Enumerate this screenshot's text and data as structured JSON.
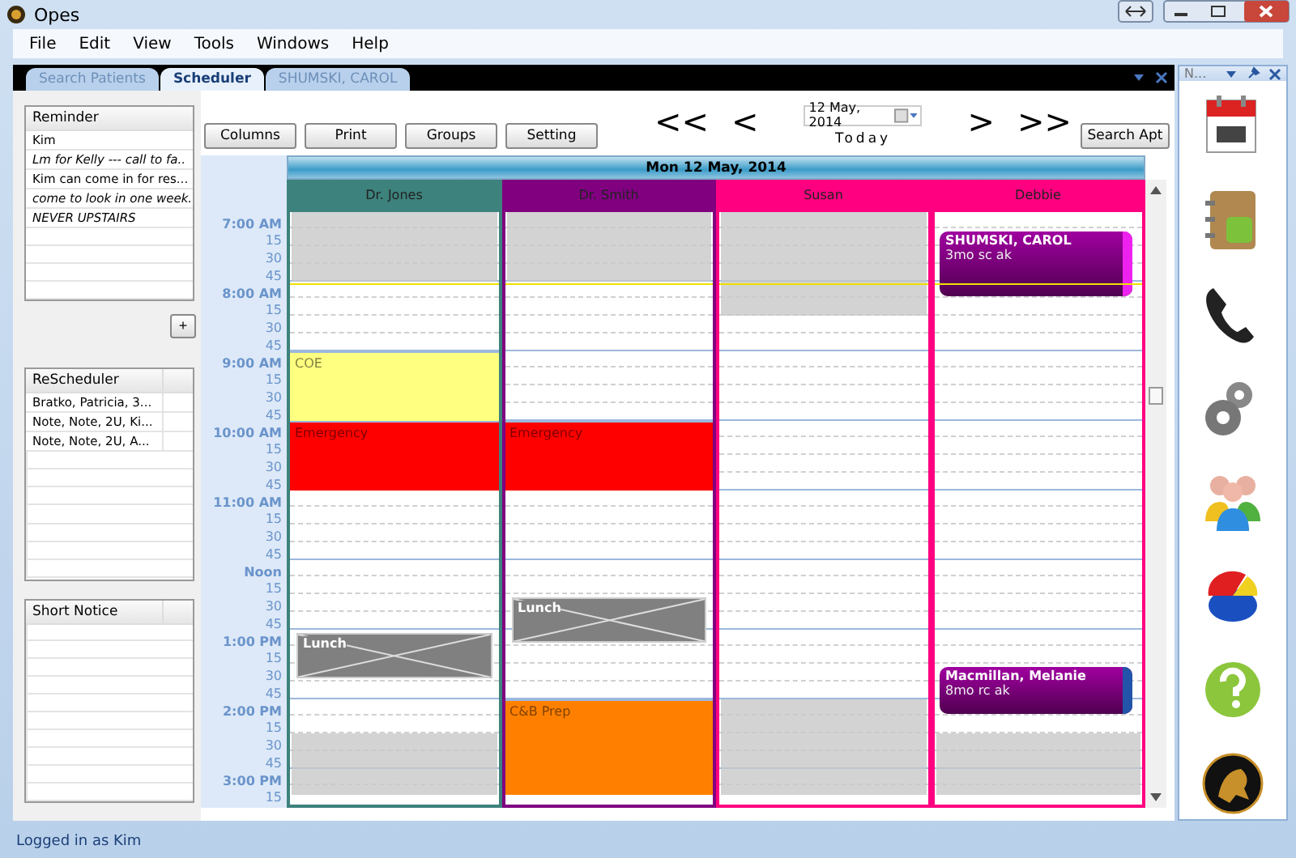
{
  "window": {
    "title": "Opes"
  },
  "menu": [
    "File",
    "Edit",
    "View",
    "Tools",
    "Windows",
    "Help"
  ],
  "tabs": [
    {
      "label": "Search Patients",
      "selected": false
    },
    {
      "label": "Scheduler",
      "selected": true
    },
    {
      "label": "SHUMSKI, CAROL",
      "selected": false
    }
  ],
  "reminder": {
    "title": "Reminder",
    "items": [
      {
        "text": "Kim",
        "italic": false
      },
      {
        "text": "Lm for Kelly --- call to fa..",
        "italic": true
      },
      {
        "text": "Kim can come in for res...",
        "italic": false
      },
      {
        "text": "come to look in one week.",
        "italic": true
      },
      {
        "text": "NEVER UPSTAIRS",
        "italic": true
      }
    ]
  },
  "add_button": "+",
  "rescheduler": {
    "title": "ReScheduler",
    "items": [
      "Bratko, Patricia, 3...",
      "Note, Note, 2U, Ki...",
      "Note, Note, 2U, A..."
    ]
  },
  "short_notice": {
    "title": "Short Notice"
  },
  "toolbar": {
    "buttons": [
      "Columns",
      "Print",
      "Groups",
      "Setting"
    ],
    "nav_back": [
      "<<",
      "<"
    ],
    "date": "12 May, 2014",
    "today": "Today",
    "nav_forward": [
      ">",
      ">>"
    ],
    "search_button": "Search Apt"
  },
  "schedule": {
    "date_header": "Mon 12 May, 2014",
    "columns": [
      {
        "name": "Dr. Jones",
        "color": "#3d827c"
      },
      {
        "name": "Dr. Smith",
        "color": "#800080"
      },
      {
        "name": "Susan",
        "color": "#ff0080"
      },
      {
        "name": "Debbie",
        "color": "#ff0080"
      }
    ],
    "rows": [
      {
        "time": "7:00 AM",
        "current": false,
        "cells": [
          {
            "kind": "unavailable"
          },
          {
            "kind": "unavailable"
          },
          {
            "kind": "unavailable"
          },
          {
            "kind": "free"
          }
        ]
      },
      {
        "time": "15",
        "current": false,
        "cells": [
          {
            "kind": "unavailable"
          },
          {
            "kind": "unavailable"
          },
          {
            "kind": "unavailable"
          },
          {
            "kind": "appointment",
            "name": "SHUMSKI, CAROL",
            "note": "3mo sc ak",
            "color": "#ee22ee"
          }
        ]
      },
      {
        "time": "30",
        "current": false,
        "cells": [
          {
            "kind": "unavailable"
          },
          {
            "kind": "unavailable"
          },
          {
            "kind": "unavailable"
          },
          {
            "kind": "cont"
          }
        ]
      },
      {
        "time": "45",
        "current": false,
        "cells": [
          {
            "kind": "unavailable"
          },
          {
            "kind": "unavailable"
          },
          {
            "kind": "unavailable"
          },
          {
            "kind": "cont"
          }
        ]
      },
      {
        "time": "8:00 AM",
        "current": true,
        "cells": [
          {
            "kind": "free"
          },
          {
            "kind": "free"
          },
          {
            "kind": "unavailable"
          },
          {
            "kind": "cont"
          }
        ]
      },
      {
        "time": "15",
        "current": false,
        "cells": [
          {
            "kind": "free"
          },
          {
            "kind": "free"
          },
          {
            "kind": "unavailable"
          },
          {
            "kind": "free"
          }
        ]
      },
      {
        "time": "30",
        "current": false,
        "cells": [
          {
            "kind": "free"
          },
          {
            "kind": "free"
          },
          {
            "kind": "free"
          },
          {
            "kind": "free"
          }
        ]
      },
      {
        "time": "45",
        "current": false,
        "cells": [
          {
            "kind": "free"
          },
          {
            "kind": "free"
          },
          {
            "kind": "free"
          },
          {
            "kind": "free"
          }
        ]
      },
      {
        "time": "9:00 AM",
        "current": false,
        "cells": [
          {
            "kind": "block",
            "label": "COE",
            "color": "#ffff80"
          },
          {
            "kind": "free"
          },
          {
            "kind": "free"
          },
          {
            "kind": "free"
          }
        ]
      },
      {
        "time": "15",
        "current": false,
        "cells": [
          {
            "kind": "cont"
          },
          {
            "kind": "free"
          },
          {
            "kind": "free"
          },
          {
            "kind": "free"
          }
        ]
      },
      {
        "time": "30",
        "current": false,
        "cells": [
          {
            "kind": "cont"
          },
          {
            "kind": "free"
          },
          {
            "kind": "free"
          },
          {
            "kind": "free"
          }
        ]
      },
      {
        "time": "45",
        "current": false,
        "cells": [
          {
            "kind": "cont"
          },
          {
            "kind": "free"
          },
          {
            "kind": "free"
          },
          {
            "kind": "free"
          }
        ]
      },
      {
        "time": "10:00 AM",
        "current": false,
        "cells": [
          {
            "kind": "block",
            "label": "Emergency",
            "color": "#ff0000"
          },
          {
            "kind": "block",
            "label": "Emergency",
            "color": "#ff0000"
          },
          {
            "kind": "free"
          },
          {
            "kind": "free"
          }
        ]
      },
      {
        "time": "15",
        "current": false,
        "cells": [
          {
            "kind": "cont"
          },
          {
            "kind": "cont"
          },
          {
            "kind": "free"
          },
          {
            "kind": "free"
          }
        ]
      },
      {
        "time": "30",
        "current": false,
        "cells": [
          {
            "kind": "cont"
          },
          {
            "kind": "cont"
          },
          {
            "kind": "free"
          },
          {
            "kind": "free"
          }
        ]
      },
      {
        "time": "45",
        "current": false,
        "cells": [
          {
            "kind": "cont"
          },
          {
            "kind": "cont"
          },
          {
            "kind": "free"
          },
          {
            "kind": "free"
          }
        ]
      },
      {
        "time": "11:00 AM",
        "current": false,
        "cells": [
          {
            "kind": "free"
          },
          {
            "kind": "free"
          },
          {
            "kind": "free"
          },
          {
            "kind": "free"
          }
        ]
      },
      {
        "time": "15",
        "current": false,
        "cells": [
          {
            "kind": "free"
          },
          {
            "kind": "free"
          },
          {
            "kind": "free"
          },
          {
            "kind": "free"
          }
        ]
      },
      {
        "time": "30",
        "current": false,
        "cells": [
          {
            "kind": "free"
          },
          {
            "kind": "free"
          },
          {
            "kind": "free"
          },
          {
            "kind": "free"
          }
        ]
      },
      {
        "time": "45",
        "current": false,
        "cells": [
          {
            "kind": "free"
          },
          {
            "kind": "free"
          },
          {
            "kind": "free"
          },
          {
            "kind": "free"
          }
        ]
      },
      {
        "time": "Noon",
        "current": false,
        "cells": [
          {
            "kind": "free"
          },
          {
            "kind": "free"
          },
          {
            "kind": "free"
          },
          {
            "kind": "free"
          }
        ]
      },
      {
        "time": "15",
        "current": false,
        "cells": [
          {
            "kind": "free"
          },
          {
            "kind": "free"
          },
          {
            "kind": "free"
          },
          {
            "kind": "free"
          }
        ]
      },
      {
        "time": "30",
        "current": false,
        "cells": [
          {
            "kind": "free"
          },
          {
            "kind": "lunch",
            "label": "Lunch"
          },
          {
            "kind": "free"
          },
          {
            "kind": "free"
          }
        ]
      },
      {
        "time": "45",
        "current": false,
        "cells": [
          {
            "kind": "free"
          },
          {
            "kind": "cont"
          },
          {
            "kind": "free"
          },
          {
            "kind": "free"
          }
        ]
      },
      {
        "time": "1:00 PM",
        "current": false,
        "cells": [
          {
            "kind": "lunch",
            "label": "Lunch"
          },
          {
            "kind": "cont"
          },
          {
            "kind": "free"
          },
          {
            "kind": "free"
          }
        ]
      },
      {
        "time": "15",
        "current": false,
        "cells": [
          {
            "kind": "cont"
          },
          {
            "kind": "free"
          },
          {
            "kind": "free"
          },
          {
            "kind": "free"
          }
        ]
      },
      {
        "time": "30",
        "current": false,
        "cells": [
          {
            "kind": "cont"
          },
          {
            "kind": "free"
          },
          {
            "kind": "free"
          },
          {
            "kind": "appointment",
            "name": "Macmillan, Melanie",
            "note": "8mo rc ak",
            "color": "#2255aa"
          }
        ]
      },
      {
        "time": "45",
        "current": false,
        "cells": [
          {
            "kind": "free"
          },
          {
            "kind": "free"
          },
          {
            "kind": "free"
          },
          {
            "kind": "cont"
          }
        ]
      },
      {
        "time": "2:00 PM",
        "current": false,
        "cells": [
          {
            "kind": "free"
          },
          {
            "kind": "block",
            "label": "C&B Prep",
            "color": "#ff8000"
          },
          {
            "kind": "unavailable"
          },
          {
            "kind": "cont"
          }
        ]
      },
      {
        "time": "15",
        "current": false,
        "cells": [
          {
            "kind": "free"
          },
          {
            "kind": "cont"
          },
          {
            "kind": "unavailable"
          },
          {
            "kind": "free"
          }
        ]
      },
      {
        "time": "30",
        "current": false,
        "cells": [
          {
            "kind": "unavailable"
          },
          {
            "kind": "cont"
          },
          {
            "kind": "unavailable"
          },
          {
            "kind": "unavailable"
          }
        ]
      },
      {
        "time": "45",
        "current": false,
        "cells": [
          {
            "kind": "unavailable"
          },
          {
            "kind": "cont"
          },
          {
            "kind": "unavailable"
          },
          {
            "kind": "unavailable"
          }
        ]
      },
      {
        "time": "3:00 PM",
        "current": false,
        "cells": [
          {
            "kind": "unavailable"
          },
          {
            "kind": "cont"
          },
          {
            "kind": "unavailable"
          },
          {
            "kind": "unavailable"
          }
        ]
      },
      {
        "time": "15",
        "current": false,
        "cells": [
          {
            "kind": "unavailable"
          },
          {
            "kind": "cont"
          },
          {
            "kind": "unavailable"
          },
          {
            "kind": "unavailable"
          }
        ]
      }
    ]
  },
  "dock": {
    "title": "N..."
  },
  "status_bar": "Logged in as Kim"
}
